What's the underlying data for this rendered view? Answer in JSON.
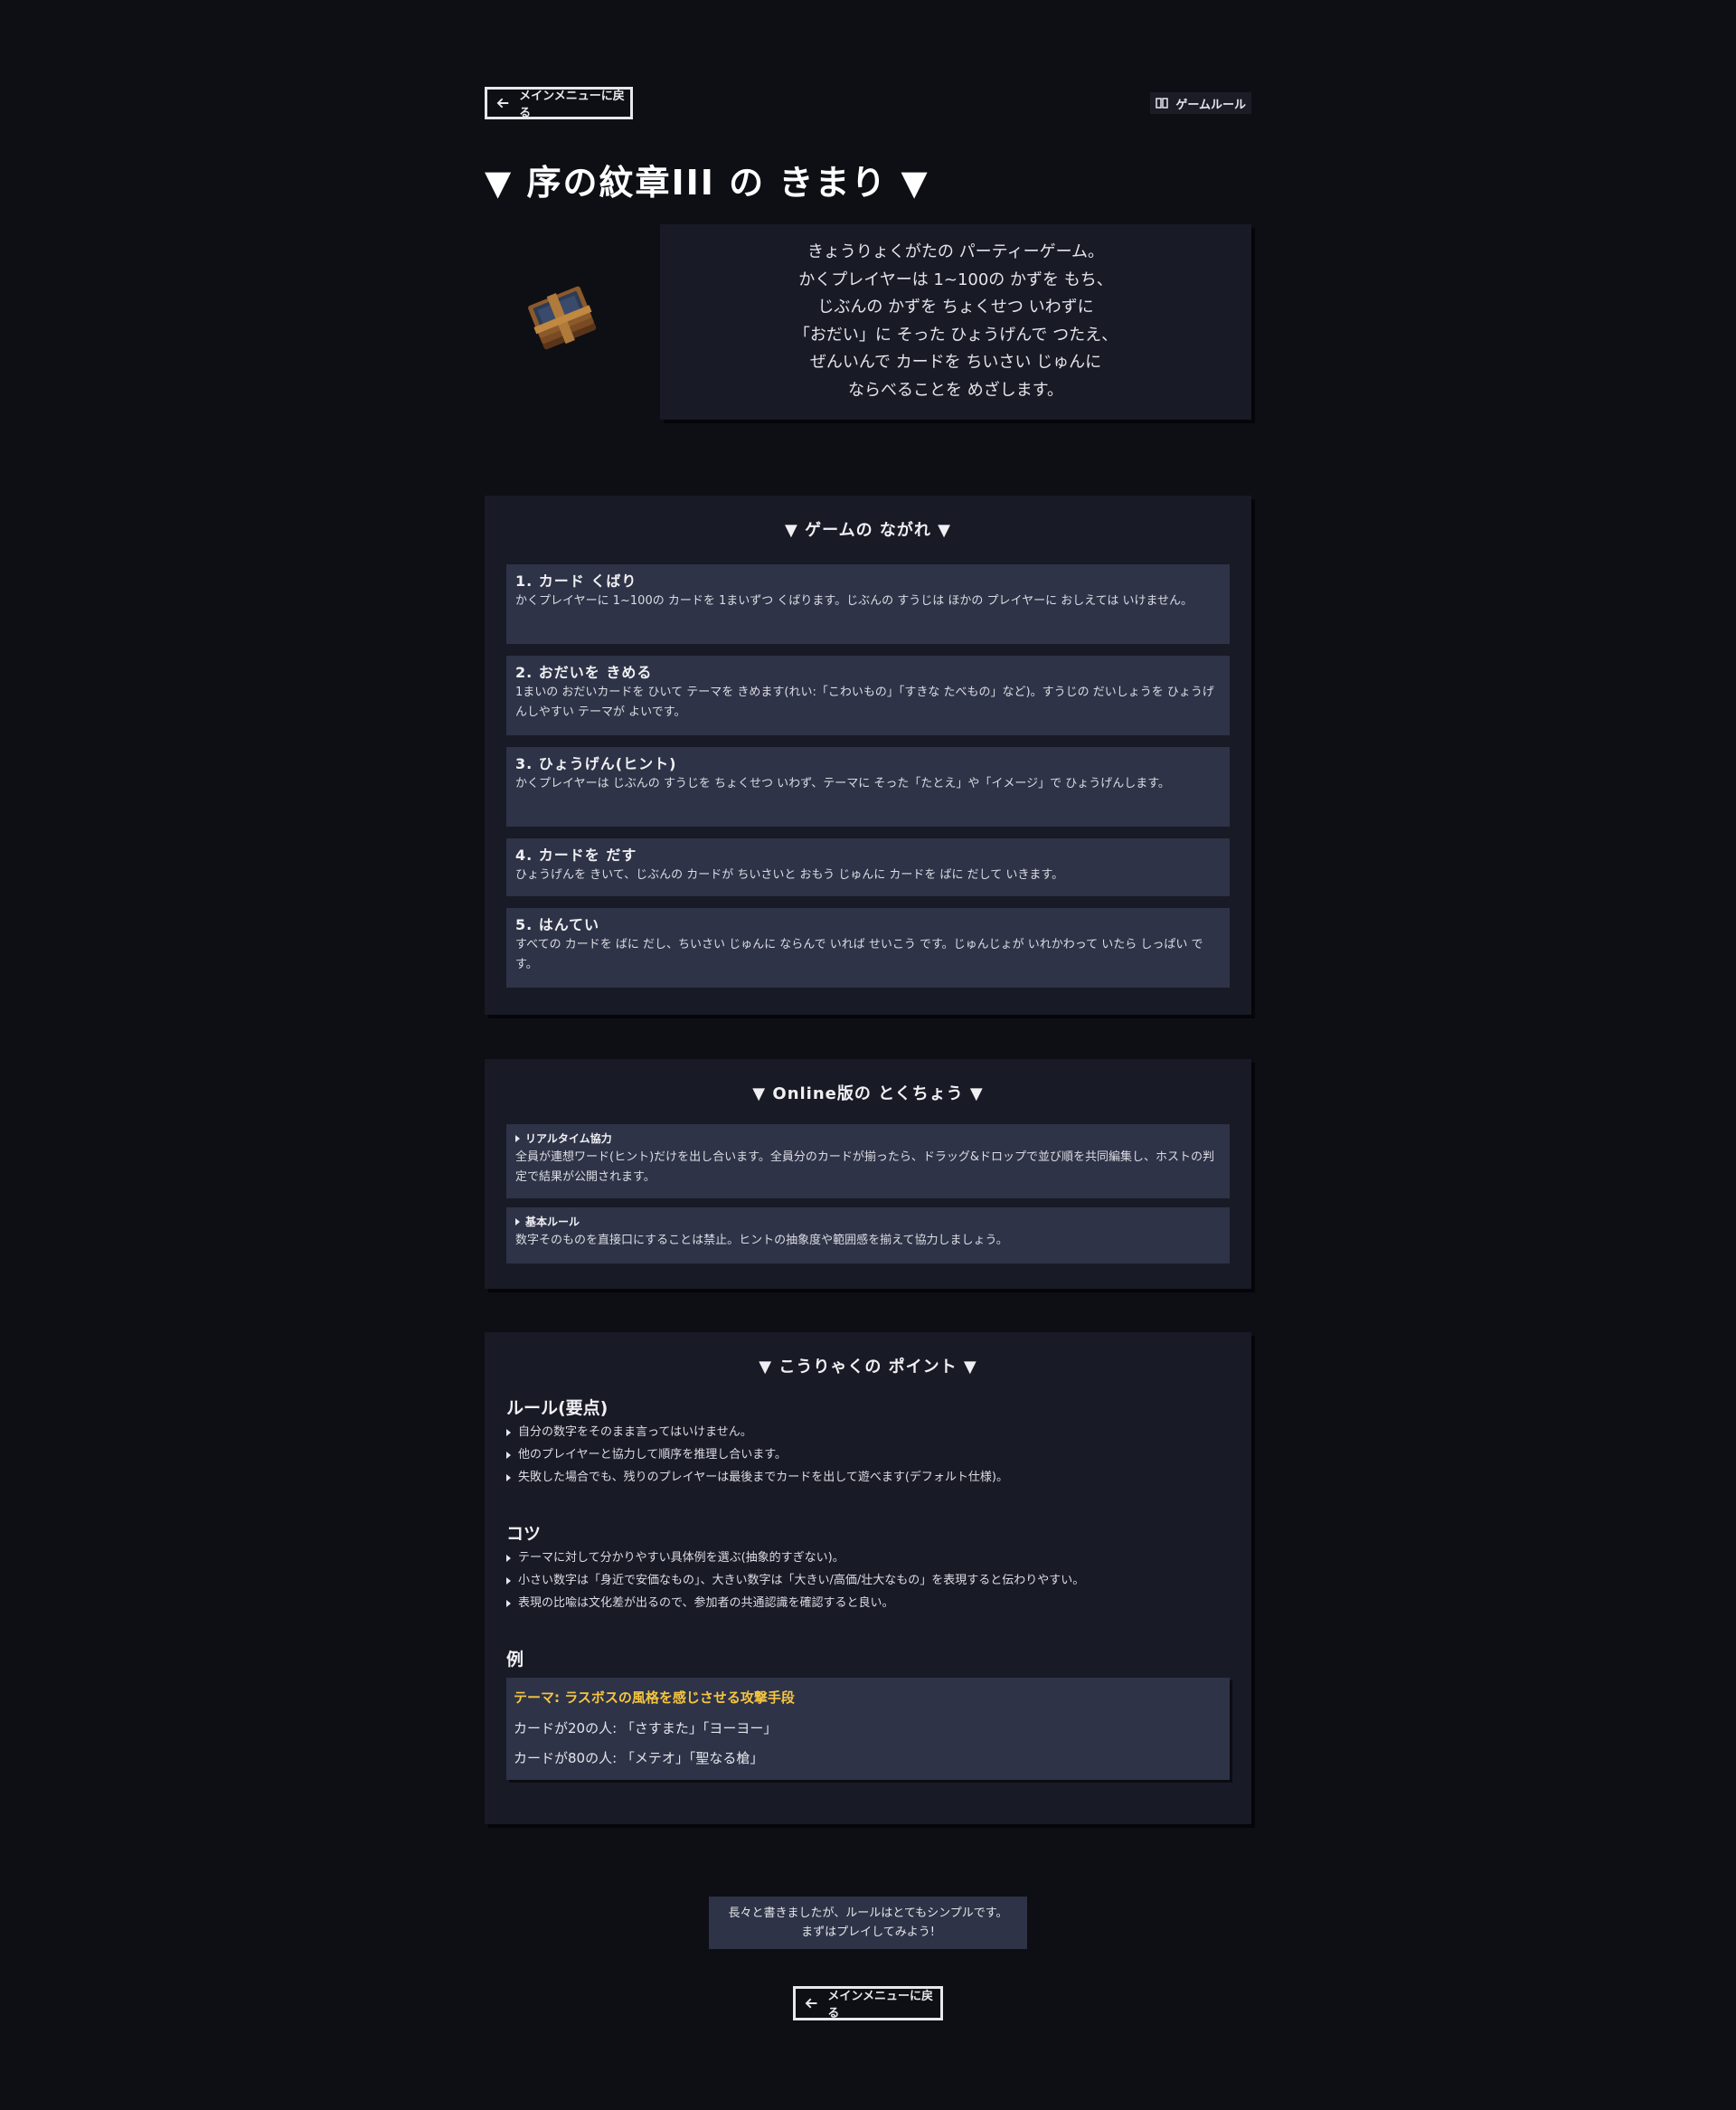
{
  "nav": {
    "back_label": "メインメニューに戻る",
    "rules_label": "ゲームルール"
  },
  "title": "▼ 序の紋章III の きまり ▼",
  "intro": {
    "lines": [
      "きょうりょくがたの パーティーゲーム。",
      "かくプレイヤーは 1~100の かずを もち、",
      "じぶんの かずを ちょくせつ いわずに",
      "「おだい」に そった ひょうげんで つたえ、",
      "ぜんいんで カードを ちいさい じゅんに",
      "ならべることを めざします。"
    ]
  },
  "flow": {
    "title": "▼ ゲームの ながれ ▼",
    "steps": [
      {
        "title": "1. カード くばり",
        "desc": "かくプレイヤーに 1~100の カードを 1まいずつ くばります。じぶんの すうじは ほかの プレイヤーに おしえては いけません。"
      },
      {
        "title": "2. おだいを きめる",
        "desc": "1まいの おだいカードを ひいて テーマを きめます(れい:「こわいもの」「すきな たべもの」など)。すうじの だいしょうを ひょうげんしやすい テーマが よいです。"
      },
      {
        "title": "3. ひょうげん(ヒント)",
        "desc": "かくプレイヤーは じぶんの すうじを ちょくせつ いわず、テーマに そった「たとえ」や「イメージ」で ひょうげんします。"
      },
      {
        "title": "4. カードを だす",
        "desc": "ひょうげんを きいて、じぶんの カードが ちいさいと おもう じゅんに カードを ばに だして いきます。"
      },
      {
        "title": "5. はんてい",
        "desc": "すべての カードを ばに だし、ちいさい じゅんに ならんで いれば せいこう です。じゅんじょが いれかわって いたら しっぱい です。"
      }
    ]
  },
  "online": {
    "title": "▼ Online版の とくちょう ▼",
    "features": [
      {
        "title": "リアルタイム協力",
        "desc": "全員が連想ワード(ヒント)だけを出し合います。全員分のカードが揃ったら、ドラッグ&ドロップで並び順を共同編集し、ホストの判定で結果が公開されます。"
      },
      {
        "title": "基本ルール",
        "desc": "数字そのものを直接口にすることは禁止。ヒントの抽象度や範囲感を揃えて協力しましょう。"
      }
    ]
  },
  "tips": {
    "title": "▼ こうりゃくの ポイント ▼",
    "rules_heading": "ルール(要点)",
    "rules": [
      "自分の数字をそのまま言ってはいけません。",
      "他のプレイヤーと協力して順序を推理し合います。",
      "失敗した場合でも、残りのプレイヤーは最後までカードを出して遊べます(デフォルト仕様)。"
    ],
    "kotsu_heading": "コツ",
    "kotsu": [
      "テーマに対して分かりやすい具体例を選ぶ(抽象的すぎない)。",
      "小さい数字は「身近で安価なもの」、大きい数字は「大きい/高価/壮大なもの」を表現すると伝わりやすい。",
      "表現の比喩は文化差が出るので、参加者の共通認識を確認すると良い。"
    ],
    "example_heading": "例",
    "example": {
      "theme": "テーマ: ラスボスの風格を感じさせる攻撃手段",
      "line1": "カードが20の人: 「さすまた」「ヨーヨー」",
      "line2": "カードが80の人: 「メテオ」「聖なる槍」"
    }
  },
  "closing": {
    "line1": "長々と書きましたが、ルールはとてもシンプルです。",
    "line2": "まずはプレイしてみよう!"
  },
  "colors": {
    "background": "#0e0f14",
    "panel": "#181a25",
    "card": "#2e3347",
    "accent_theme": "#f5c542"
  }
}
